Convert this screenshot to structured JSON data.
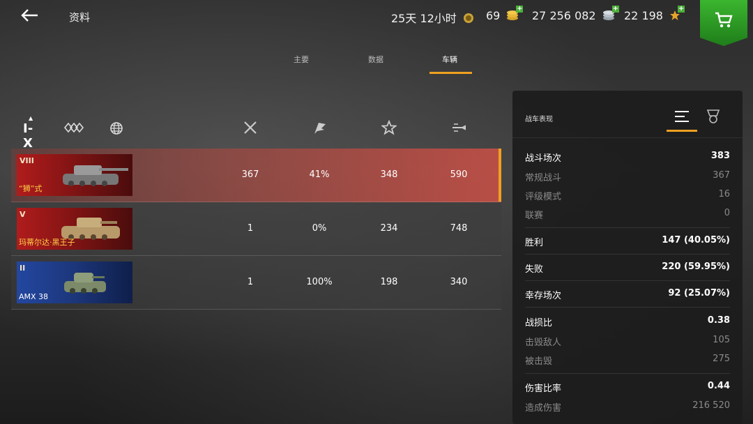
{
  "header": {
    "title": "资料",
    "premium_time": "25天 12小时",
    "gold": "69",
    "credits": "27 256 082",
    "free_xp": "22 198"
  },
  "tabs": [
    "主要",
    "数据",
    "车辆"
  ],
  "active_tab": "车辆",
  "filters": {
    "tier": "I-X"
  },
  "vehicles": [
    {
      "tier": "VIII",
      "name": "“狮”式",
      "battles": "367",
      "win_rate": "41%",
      "avg_xp": "348",
      "avg_damage": "590",
      "card_color": "red"
    },
    {
      "tier": "V",
      "name": "玛蒂尔达·黑王子",
      "battles": "1",
      "win_rate": "0%",
      "avg_xp": "234",
      "avg_damage": "748",
      "card_color": "red"
    },
    {
      "tier": "II",
      "name": "AMX 38",
      "battles": "1",
      "win_rate": "100%",
      "avg_xp": "198",
      "avg_damage": "340",
      "card_color": "blue"
    }
  ],
  "panel": {
    "title": "战车表现",
    "rows": [
      {
        "label": "战斗场次",
        "value": "383",
        "sub": false
      },
      {
        "label": "常规战斗",
        "value": "367",
        "sub": true
      },
      {
        "label": "评级模式",
        "value": "16",
        "sub": true
      },
      {
        "label": "联赛",
        "value": "0",
        "sub": true
      },
      {
        "label": "胜利",
        "value": "147 (40.05%)",
        "sub": false
      },
      {
        "label": "失败",
        "value": "220 (59.95%)",
        "sub": false
      },
      {
        "label": "幸存场次",
        "value": "92 (25.07%)",
        "sub": false
      },
      {
        "label": "战损比",
        "value": "0.38",
        "sub": false
      },
      {
        "label": "击毁敌人",
        "value": "105",
        "sub": true
      },
      {
        "label": "被击毁",
        "value": "275",
        "sub": true
      },
      {
        "label": "伤害比率",
        "value": "0.44",
        "sub": false
      },
      {
        "label": "造成伤害",
        "value": "216 520",
        "sub": true
      }
    ]
  },
  "colors": {
    "accent": "#f0a020",
    "shop": "#2e9c25",
    "selected_row": "#cd5046"
  },
  "icons": [
    "back-arrow-icon",
    "premium-laurel-icon",
    "gold-coins-icon",
    "credits-icon",
    "star-xp-icon",
    "cart-icon",
    "nation-icon",
    "globe-icon",
    "battles-swords-icon",
    "victory-flag-icon",
    "star-icon",
    "damage-shell-icon",
    "list-icon",
    "award-icon"
  ]
}
